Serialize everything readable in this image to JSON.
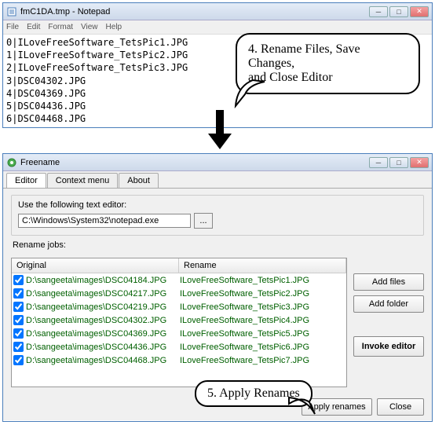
{
  "notepad": {
    "title": "fmC1DA.tmp - Notepad",
    "menu": {
      "file": "File",
      "edit": "Edit",
      "format": "Format",
      "view": "View",
      "help": "Help"
    },
    "lines": [
      "0|ILoveFreeSoftware_TetsPic1.JPG",
      "1|ILoveFreeSoftware_TetsPic2.JPG",
      "2|ILoveFreeSoftware_TetsPic3.JPG",
      "3|DSC04302.JPG",
      "4|DSC04369.JPG",
      "5|DSC04436.JPG",
      "6|DSC04468.JPG"
    ]
  },
  "callout1": {
    "line1": "4. Rename Files, Save Changes,",
    "line2": "and Close Editor"
  },
  "callout2": {
    "text": "5. Apply Renames"
  },
  "freename": {
    "title": "Freename",
    "tabs": {
      "editor": "Editor",
      "context": "Context menu",
      "about": "About"
    },
    "editor_group": "Use the following text editor:",
    "editor_path": "C:\\Windows\\System32\\notepad.exe",
    "browse": "...",
    "rename_label": "Rename jobs:",
    "headers": {
      "original": "Original",
      "rename": "Rename"
    },
    "rows": [
      {
        "orig": "D:\\sangeeta\\images\\DSC04184.JPG",
        "ren": "ILoveFreeSoftware_TetsPic1.JPG"
      },
      {
        "orig": "D:\\sangeeta\\images\\DSC04217.JPG",
        "ren": "ILoveFreeSoftware_TetsPic2.JPG"
      },
      {
        "orig": "D:\\sangeeta\\images\\DSC04219.JPG",
        "ren": "ILoveFreeSoftware_TetsPic3.JPG"
      },
      {
        "orig": "D:\\sangeeta\\images\\DSC04302.JPG",
        "ren": "ILoveFreeSoftware_TetsPic4.JPG"
      },
      {
        "orig": "D:\\sangeeta\\images\\DSC04369.JPG",
        "ren": "ILoveFreeSoftware_TetsPic5.JPG"
      },
      {
        "orig": "D:\\sangeeta\\images\\DSC04436.JPG",
        "ren": "ILoveFreeSoftware_TetsPic6.JPG"
      },
      {
        "orig": "D:\\sangeeta\\images\\DSC04468.JPG",
        "ren": "ILoveFreeSoftware_TetsPic7.JPG"
      }
    ],
    "buttons": {
      "add_files": "Add files",
      "add_folder": "Add folder",
      "invoke": "Invoke editor",
      "apply": "Apply renames",
      "close": "Close"
    }
  }
}
